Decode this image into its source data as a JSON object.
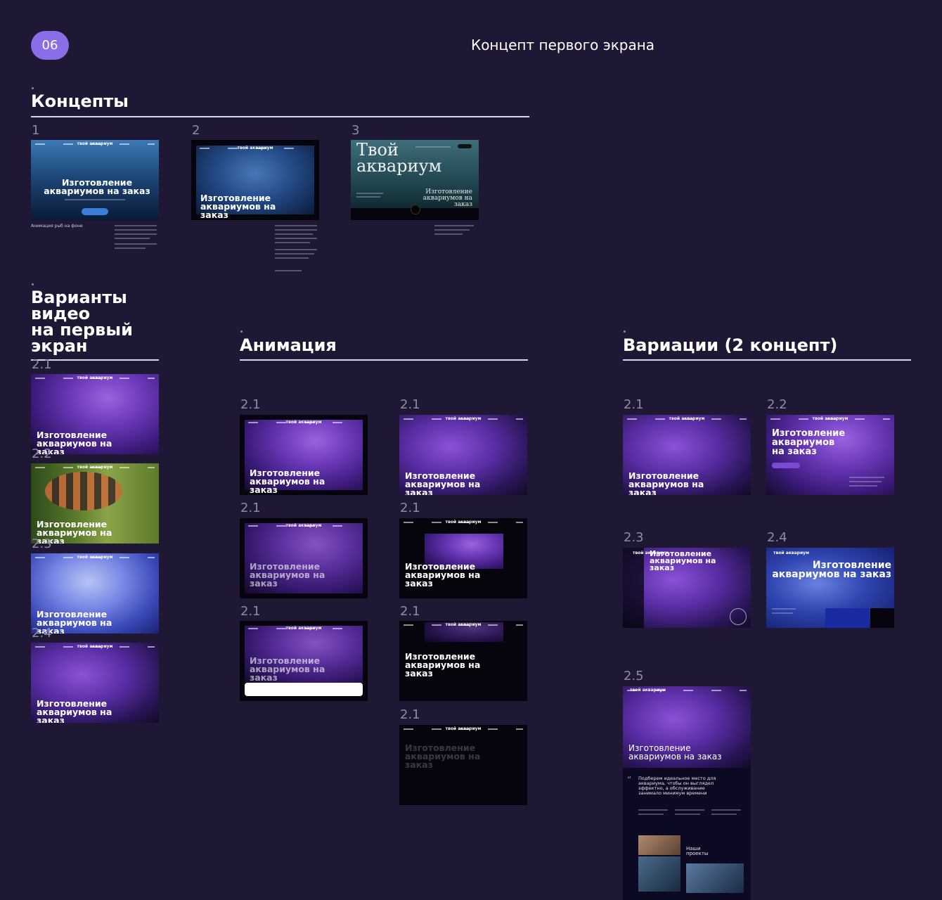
{
  "header": {
    "badge": "06",
    "title": "Концепт первого экрана"
  },
  "sections": {
    "concepts": {
      "title": "Концепты",
      "items": [
        {
          "num": "1",
          "caption": "Изготовление аквариумов на заказ",
          "note": "Анимация рыб на фоне"
        },
        {
          "num": "2",
          "caption": "Изготовление аквариумов на заказ"
        },
        {
          "num": "3",
          "big": "Твой аквариум",
          "caption": "Изготовление аквариумов на заказ"
        }
      ]
    },
    "video": {
      "title_lines": [
        "Варианты",
        "видео",
        "на первый",
        "экран"
      ],
      "items": [
        {
          "num": "2.1",
          "caption": "Изготовление аквариумов на заказ"
        },
        {
          "num": "2.2",
          "caption": "Изготовление аквариумов на заказ"
        },
        {
          "num": "2.3",
          "caption": "Изготовление аквариумов на заказ"
        },
        {
          "num": "2.4",
          "caption": "Изготовление аквариумов на заказ"
        }
      ]
    },
    "animation": {
      "title": "Анимация",
      "items": [
        {
          "num": "2.1",
          "caption": "Изготовление аквариумов на заказ"
        },
        {
          "num": "2.1",
          "caption": "Изготовление аквариумов на заказ"
        },
        {
          "num": "2.1",
          "caption": "Изготовление аквариумов на заказ"
        },
        {
          "num": "2.1",
          "caption": "Изготовление аквариумов на заказ"
        },
        {
          "num": "2.1",
          "caption": "Изготовление аквариумов на заказ"
        },
        {
          "num": "2.1",
          "caption": "Изготовление аквариумов на заказ"
        },
        {
          "num": "2.1",
          "caption": "Изготовление аквариумов на заказ"
        }
      ]
    },
    "variations": {
      "title": "Вариации (2 концепт)",
      "items": [
        {
          "num": "2.1",
          "caption": "Изготовление аквариумов на заказ"
        },
        {
          "num": "2.2",
          "caption": "Изготовление аквариумов на заказ"
        },
        {
          "num": "2.3",
          "caption": "Изготовление аквариумов на заказ"
        },
        {
          "num": "2.4",
          "caption": "Изготовление аквариумов на заказ"
        },
        {
          "num": "2.5",
          "caption": "Изготовление аквариумов на заказ",
          "quote": "Подберем идеальное место для аквариума, чтобы он выглядел эффектно, а обслуживание занимало минимум времени",
          "projects": "Наши проекты"
        }
      ]
    }
  },
  "thumb_logo": "твой аквариум"
}
